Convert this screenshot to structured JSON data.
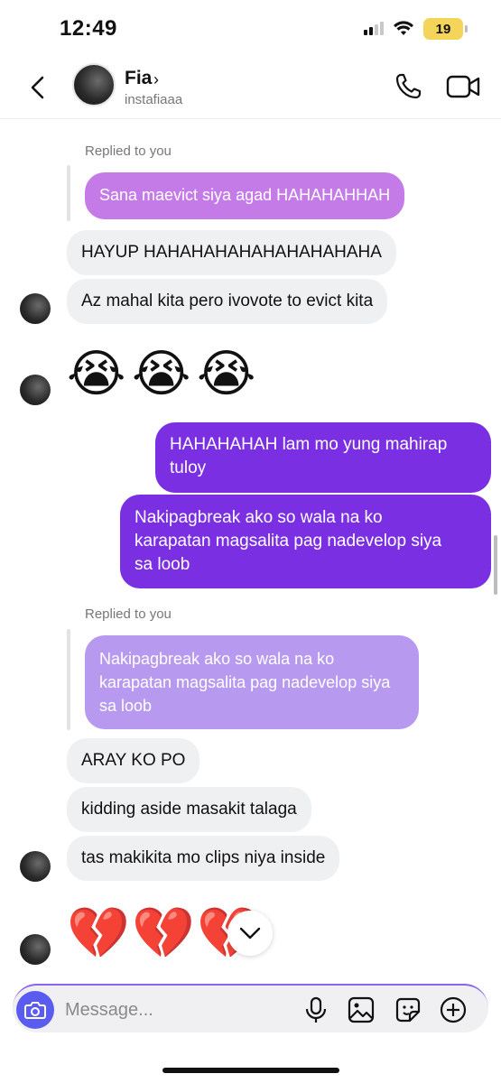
{
  "status_bar": {
    "time": "12:49",
    "battery": "19"
  },
  "header": {
    "contact_name": "Fia",
    "name_chevron": "›",
    "username": "instafiaaa",
    "icons": [
      "back-chevron-icon",
      "phone-icon",
      "video-camera-icon"
    ]
  },
  "messages": {
    "replied_label_1": "Replied to you",
    "reply_quote_1": "Sana maevict siya agad HAHAHAHHAH",
    "in_1": "HAYUP HAHAHAHAHAHAHAHAHAHA",
    "in_2": "Az mahal kita pero ivovote to evict kita",
    "emoji_crying": "😭",
    "out_1_line1": "HAHAHAHAH lam mo yung mahirap",
    "out_1_line2": "tuloy",
    "out_2_line1": "Nakipagbreak ako so wala na ko",
    "out_2_line2": "karapatan magsalita pag nadevelop siya",
    "out_2_line3": "sa loob",
    "replied_label_2": "Replied to you",
    "reply_quote_2_line1": "Nakipagbreak ako so wala na ko",
    "reply_quote_2_line2": "karapatan magsalita pag nadevelop siya",
    "reply_quote_2_line3": "sa loob",
    "in_3": "ARAY KO PO",
    "in_4": "kidding aside masakit talaga",
    "in_5": "tas makikita mo clips niya inside",
    "emoji_broken_heart": "💔"
  },
  "composer": {
    "placeholder": "Message...",
    "icons": [
      "camera-icon",
      "microphone-icon",
      "gallery-icon",
      "sticker-icon",
      "plus-icon"
    ]
  },
  "colors": {
    "outgoing_bubble": "#7b2fe3",
    "incoming_bubble": "#eff0f2",
    "reply_quote_1": "#c47be8",
    "reply_quote_2": "#b79af0",
    "camera_button": "#5a5cf0",
    "battery": "#f4d55a"
  }
}
